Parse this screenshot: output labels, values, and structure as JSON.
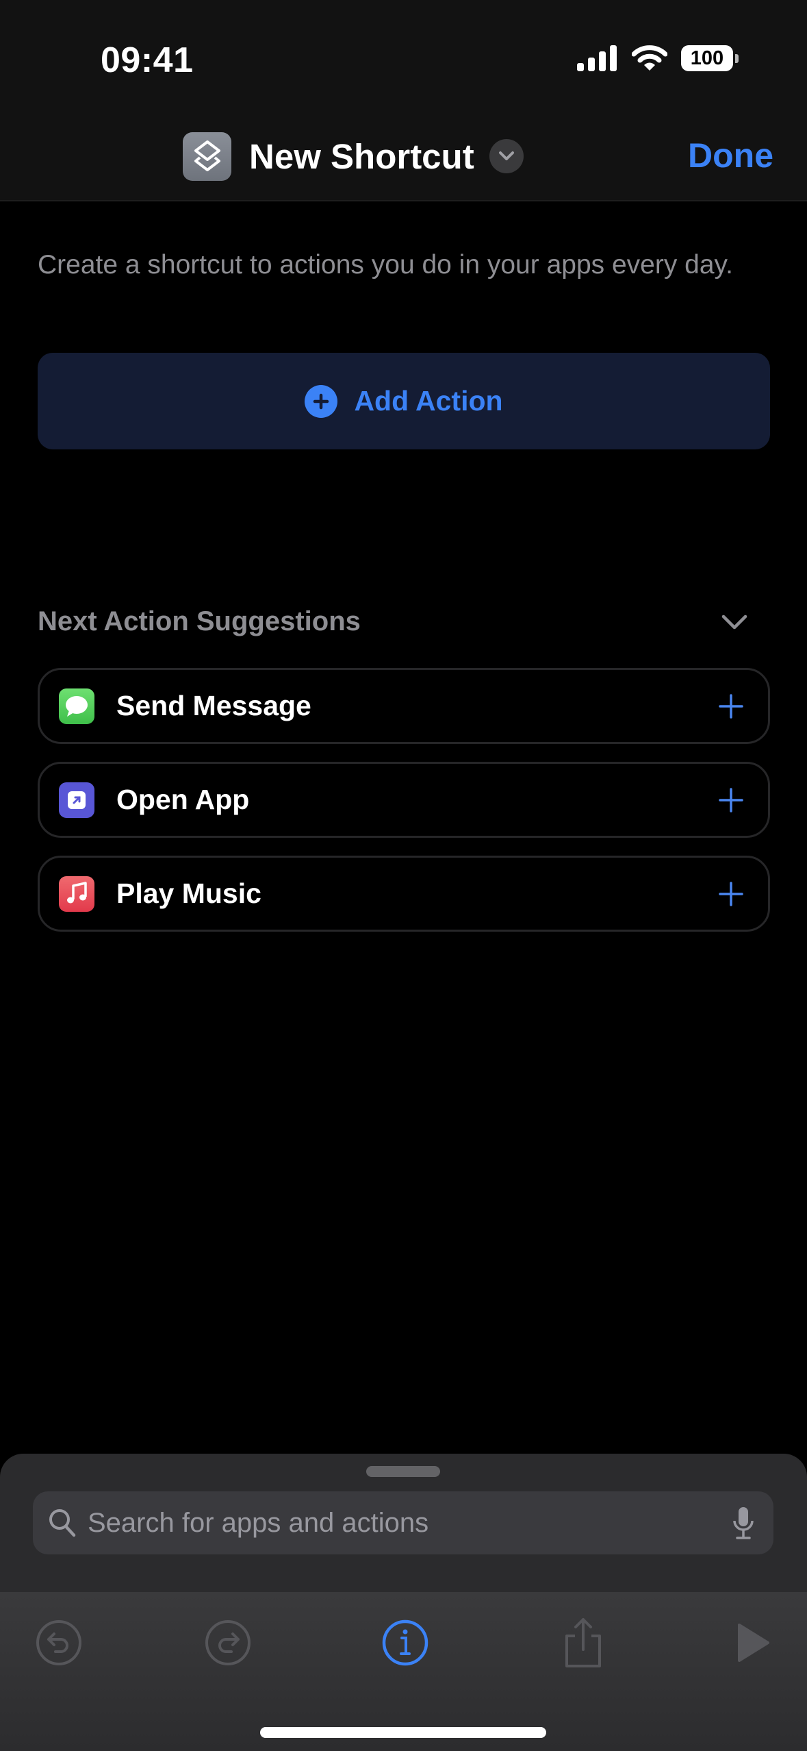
{
  "status_bar": {
    "time": "09:41",
    "battery": "100",
    "icons": [
      "cellular-signal-icon",
      "wifi-icon",
      "battery-icon"
    ]
  },
  "nav": {
    "app_icon": "shortcuts-layers-icon",
    "title": "New Shortcut",
    "title_menu_icon": "chevron-down-icon",
    "done_label": "Done"
  },
  "main": {
    "description": "Create a shortcut to actions you do in your apps every day.",
    "add_action_label": "Add Action"
  },
  "suggestions": {
    "title": "Next Action Suggestions",
    "items": [
      {
        "label": "Send Message",
        "icon": "messages-icon",
        "color": "#4cd964"
      },
      {
        "label": "Open App",
        "icon": "open-app-icon",
        "color": "#5e5ce6"
      },
      {
        "label": "Play Music",
        "icon": "music-note-icon",
        "color": "#e8434f"
      }
    ]
  },
  "search": {
    "placeholder": "Search for apps and actions",
    "value": ""
  },
  "toolbar": {
    "buttons": [
      "undo",
      "redo",
      "info",
      "share",
      "run"
    ]
  },
  "colors": {
    "accent": "#3b82f6",
    "background": "#000000",
    "secondary_text": "#8e8e93"
  }
}
